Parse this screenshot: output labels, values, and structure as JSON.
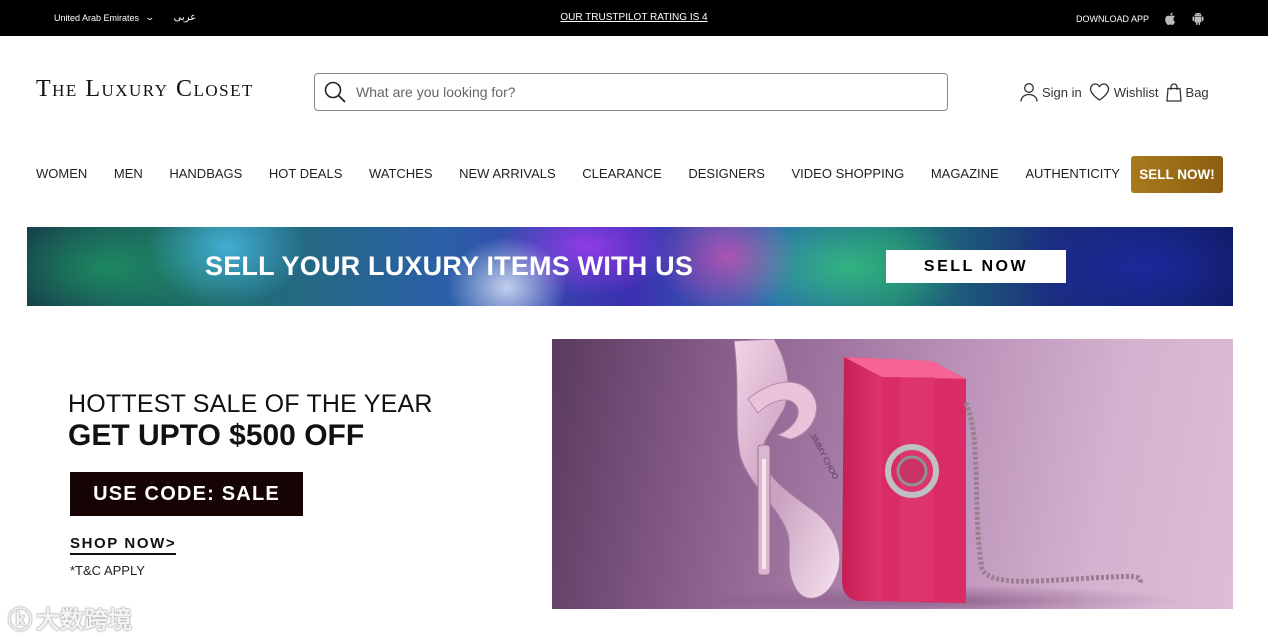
{
  "topbar": {
    "region": "United Arab Emirates",
    "language": "عربى",
    "trustpilot": "OUR TRUSTPILOT RATING IS 4",
    "download_app": "DOWNLOAD APP"
  },
  "header": {
    "logo": "The Luxury Closet",
    "search_placeholder": "What are you looking for?",
    "sign_in": "Sign in",
    "wishlist": "Wishlist",
    "bag": "Bag"
  },
  "nav": {
    "items": [
      "WOMEN",
      "MEN",
      "HANDBAGS",
      "HOT DEALS",
      "WATCHES",
      "NEW ARRIVALS",
      "CLEARANCE",
      "DESIGNERS",
      "VIDEO SHOPPING",
      "MAGAZINE",
      "AUTHENTICITY"
    ],
    "sell_now": "SELL NOW!"
  },
  "banner": {
    "headline": "SELL YOUR LUXURY ITEMS WITH US",
    "button": "SELL NOW"
  },
  "promo": {
    "line1": "HOTTEST SALE OF THE YEAR",
    "line2": "GET UPTO $500 OFF",
    "code": "USE CODE: SALE",
    "shop_now": "SHOP NOW>",
    "terms": "*T&C APPLY"
  },
  "hero": {
    "brand_on_insole": "JIMMY CHOO"
  },
  "watermark": {
    "text": "大数跨境"
  },
  "colors": {
    "topbar": "#000000",
    "sell_button": "#a97a1c",
    "code_box": "#160404",
    "bag_pink": "#e8336f",
    "hero_bg": "#b88fb6"
  }
}
